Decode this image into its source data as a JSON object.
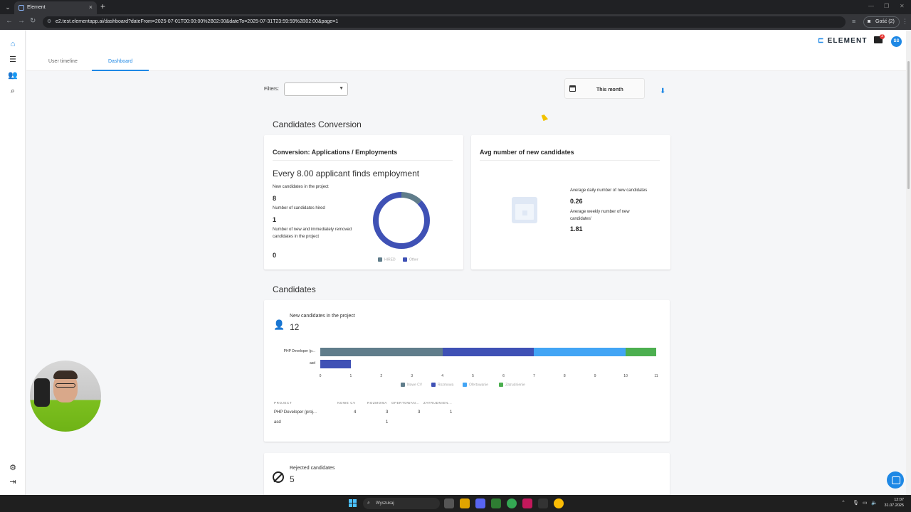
{
  "browser": {
    "tab_title": "Element",
    "tab_close": "×",
    "new_tab": "+",
    "url": "e2.test.elementapp.ai/dashboard?dateFrom=2025-07-01T00:00:00%2B02:00&dateTo=2025-07-31T23:59:59%2B02:00&page=1",
    "guest_label": "Gość (2)"
  },
  "app": {
    "logo": "ELEMENT",
    "mail_badge": "3",
    "avatar_initials": "SS",
    "tabs": [
      {
        "label": "User timeline"
      },
      {
        "label": "Dashboard"
      }
    ],
    "filters_label": "Filters:",
    "date_range": "This month"
  },
  "conversion": {
    "section_title": "Candidates Conversion",
    "card_title": "Conversion: Applications / Employments",
    "headline": "Every 8.00 applicant finds employment",
    "new_candidates_label": "New candidates in the project",
    "new_candidates_value": "8",
    "hired_label": "Number of candidates hired",
    "hired_value": "1",
    "removed_label": "Number of new and immediately removed candidates in the project",
    "removed_value": "0",
    "donut": {
      "slices": [
        {
          "name": "HIRED",
          "value": 1,
          "color": "#607d8b"
        },
        {
          "name": "Other",
          "value": 7,
          "color": "#3f51b5"
        }
      ]
    }
  },
  "avg": {
    "card_title": "Avg number of new candidates",
    "daily_label": "Average daily number of new candidates",
    "daily_value": "0.26",
    "weekly_label": "Average weekly number of new candidates'",
    "weekly_value": "1.81"
  },
  "candidates": {
    "section_title": "Candidates",
    "stat_label": "New candidates in the project",
    "stat_value": "12",
    "colors": {
      "Nowe CV": "#607d8b",
      "Rozmowa": "#3f51b5",
      "Ofertowanie": "#42a5f5",
      "Zatrudnienie": "#4caf50"
    },
    "table_headers": [
      "PROJECT",
      "NOWE CV",
      "ROZMOWA",
      "OFERTOWAN...",
      "ZATRUDNIEN..."
    ],
    "table_rows": [
      [
        "PHP Developer (proj...",
        "4",
        "3",
        "3",
        "1"
      ],
      [
        "asd",
        "",
        "1",
        "",
        ""
      ]
    ]
  },
  "chart_data": {
    "type": "bar",
    "orientation": "horizontal",
    "stacked": true,
    "categories": [
      "PHP Developer (p...",
      "asd"
    ],
    "series": [
      {
        "name": "Nowe CV",
        "values": [
          4,
          0
        ]
      },
      {
        "name": "Rozmowa",
        "values": [
          3,
          1
        ]
      },
      {
        "name": "Ofertowanie",
        "values": [
          3,
          0
        ]
      },
      {
        "name": "Zatrudnienie",
        "values": [
          1,
          0
        ]
      }
    ],
    "xlim": [
      0,
      11
    ],
    "xticks": [
      "0",
      "1",
      "2",
      "3",
      "4",
      "5",
      "6",
      "7",
      "8",
      "9",
      "10",
      "11"
    ],
    "legend": "bottom"
  },
  "rejected": {
    "label": "Rejected candidates",
    "value": "5"
  },
  "taskbar": {
    "search_placeholder": "Wyszukaj",
    "time": "12:07",
    "date": "31.07.2025"
  }
}
